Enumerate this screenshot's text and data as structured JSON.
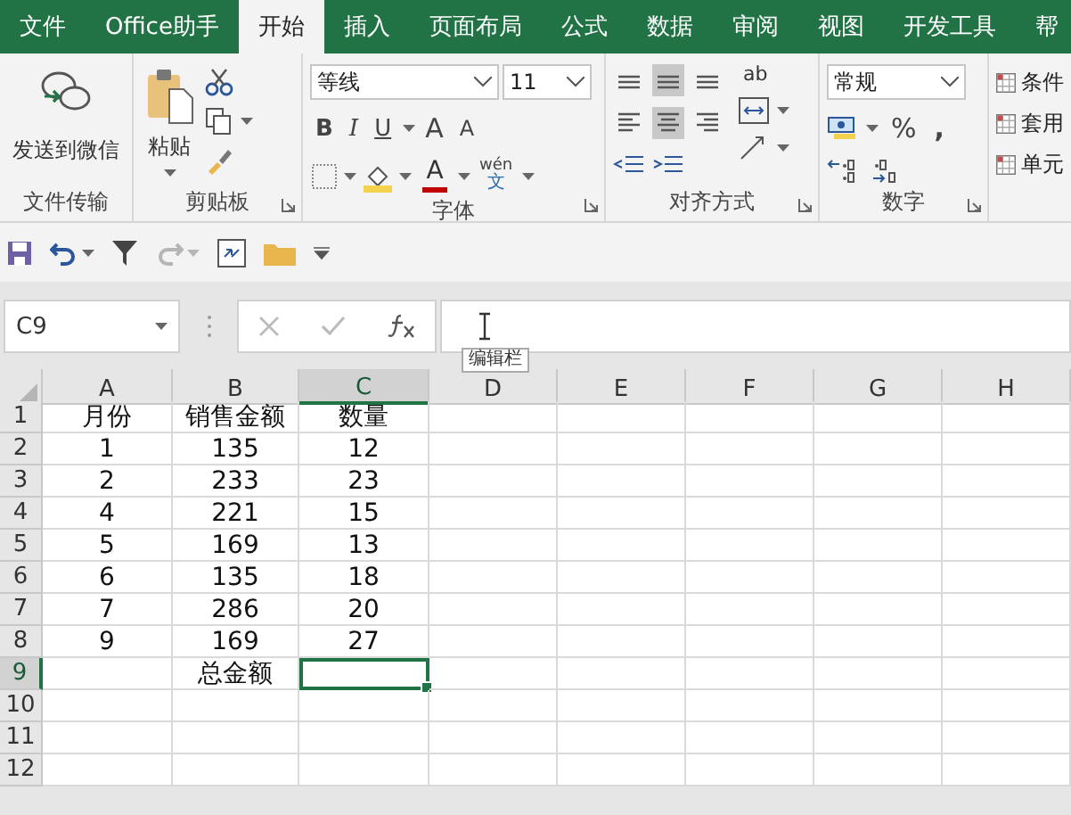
{
  "tabs": [
    {
      "label": "文件",
      "selected": false
    },
    {
      "label": "Office助手",
      "selected": false
    },
    {
      "label": "开始",
      "selected": true
    },
    {
      "label": "插入",
      "selected": false
    },
    {
      "label": "页面布局",
      "selected": false
    },
    {
      "label": "公式",
      "selected": false
    },
    {
      "label": "数据",
      "selected": false
    },
    {
      "label": "审阅",
      "selected": false
    },
    {
      "label": "视图",
      "selected": false
    },
    {
      "label": "开发工具",
      "selected": false
    },
    {
      "label": "帮",
      "selected": false
    }
  ],
  "ribbon": {
    "share": {
      "button": "发送到微信",
      "label": "文件传输"
    },
    "clipboard": {
      "paste": "粘贴",
      "label": "剪贴板"
    },
    "font": {
      "family": "等线",
      "size": "11",
      "styles": [
        "B",
        "I",
        "U"
      ],
      "grow": "A",
      "shrink": "A",
      "color_button": "A",
      "phonetic_top": "wén",
      "phonetic_bottom": "文",
      "label": "字体"
    },
    "alignment": {
      "buttons": [
        {
          "kind": "top",
          "selected": false
        },
        {
          "kind": "middle",
          "selected": true
        },
        {
          "kind": "bottom",
          "selected": false
        },
        {
          "kind": "left",
          "selected": false
        },
        {
          "kind": "center",
          "selected": true
        },
        {
          "kind": "right",
          "selected": false
        }
      ],
      "wrap": "ab",
      "label": "对齐方式"
    },
    "number": {
      "format": "常规",
      "percent": "%",
      "comma": ",",
      "label": "数字"
    },
    "styles": {
      "items": [
        "条件",
        "套用",
        "单元"
      ]
    }
  },
  "quick_access": {
    "redo_disabled": true
  },
  "formula_bar": {
    "name_box": "C9",
    "tooltip": "编辑栏"
  },
  "sheet": {
    "columns": [
      {
        "label": "A",
        "selected": false
      },
      {
        "label": "B",
        "selected": false
      },
      {
        "label": "C",
        "selected": true
      },
      {
        "label": "D",
        "selected": false
      },
      {
        "label": "E",
        "selected": false
      },
      {
        "label": "F",
        "selected": false
      },
      {
        "label": "G",
        "selected": false
      },
      {
        "label": "H",
        "selected": false
      }
    ],
    "rows": [
      {
        "number": "1",
        "selected": false,
        "cells": {
          "A": "月份",
          "B": "销售金额",
          "C": "数量"
        }
      },
      {
        "number": "2",
        "selected": false,
        "cells": {
          "A": "1",
          "B": "135",
          "C": "12"
        }
      },
      {
        "number": "3",
        "selected": false,
        "cells": {
          "A": "2",
          "B": "233",
          "C": "23"
        }
      },
      {
        "number": "4",
        "selected": false,
        "cells": {
          "A": "4",
          "B": "221",
          "C": "15"
        }
      },
      {
        "number": "5",
        "selected": false,
        "cells": {
          "A": "5",
          "B": "169",
          "C": "13"
        }
      },
      {
        "number": "6",
        "selected": false,
        "cells": {
          "A": "6",
          "B": "135",
          "C": "18"
        }
      },
      {
        "number": "7",
        "selected": false,
        "cells": {
          "A": "7",
          "B": "286",
          "C": "20"
        }
      },
      {
        "number": "8",
        "selected": false,
        "cells": {
          "A": "9",
          "B": "169",
          "C": "27"
        }
      },
      {
        "number": "9",
        "selected": true,
        "cells": {
          "B": "总金额"
        }
      },
      {
        "number": "10",
        "selected": false,
        "cells": {}
      },
      {
        "number": "11",
        "selected": false,
        "cells": {}
      },
      {
        "number": "12",
        "selected": false,
        "cells": {}
      }
    ]
  }
}
